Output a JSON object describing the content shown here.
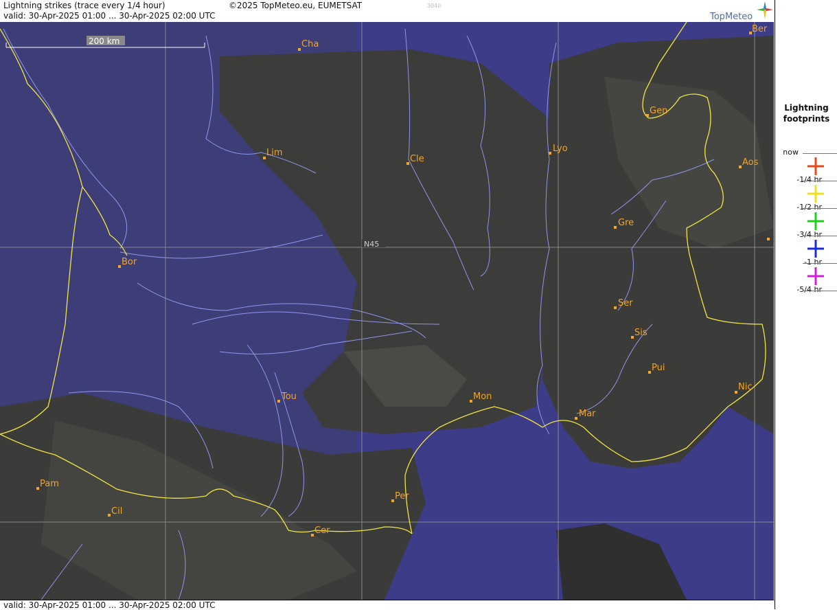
{
  "header": {
    "title": "Lightning strikes (trace every 1/4 hour)",
    "copyright": "©2025 TopMeteo.eu, EUMETSAT",
    "code": "3040",
    "valid": "valid:  30-Apr-2025 01:00 ... 30-Apr-2025 02:00 UTC",
    "brand": "TopMeteo"
  },
  "footer": {
    "valid": "valid:  30-Apr-2025 01:00 ... 30-Apr-2025 02:00 UTC"
  },
  "map": {
    "scale_label": "200 km",
    "gridline_label": "N45",
    "cities": [
      "Ber",
      "Cha",
      "Gen",
      "Lim",
      "Cle",
      "Lyo",
      "Aos",
      "Gre",
      "Bor",
      "Ser",
      "Sis",
      "Pui",
      "Tou",
      "Mon",
      "Nic",
      "Mar",
      "Pam",
      "Per",
      "Cil",
      "Cer"
    ]
  },
  "legend": {
    "title_line1": "Lightning",
    "title_line2": "footprints",
    "items": [
      {
        "label": "now",
        "color": "#e84a1a"
      },
      {
        "label": "-1/4 hr",
        "color": "#f0e020"
      },
      {
        "label": "-1/2 hr",
        "color": "#1ed01e"
      },
      {
        "label": "-3/4 hr",
        "color": "#1a2ae0"
      },
      {
        "label": "-1 hr",
        "color": "#d020d0"
      },
      {
        "label": "-5/4 hr",
        "color": ""
      }
    ]
  },
  "colors": {
    "sea": "#3c3c88",
    "land_dark": "#3a3a38",
    "border": "#f2e640",
    "river": "#8f96ee",
    "city": "#f5a623"
  }
}
